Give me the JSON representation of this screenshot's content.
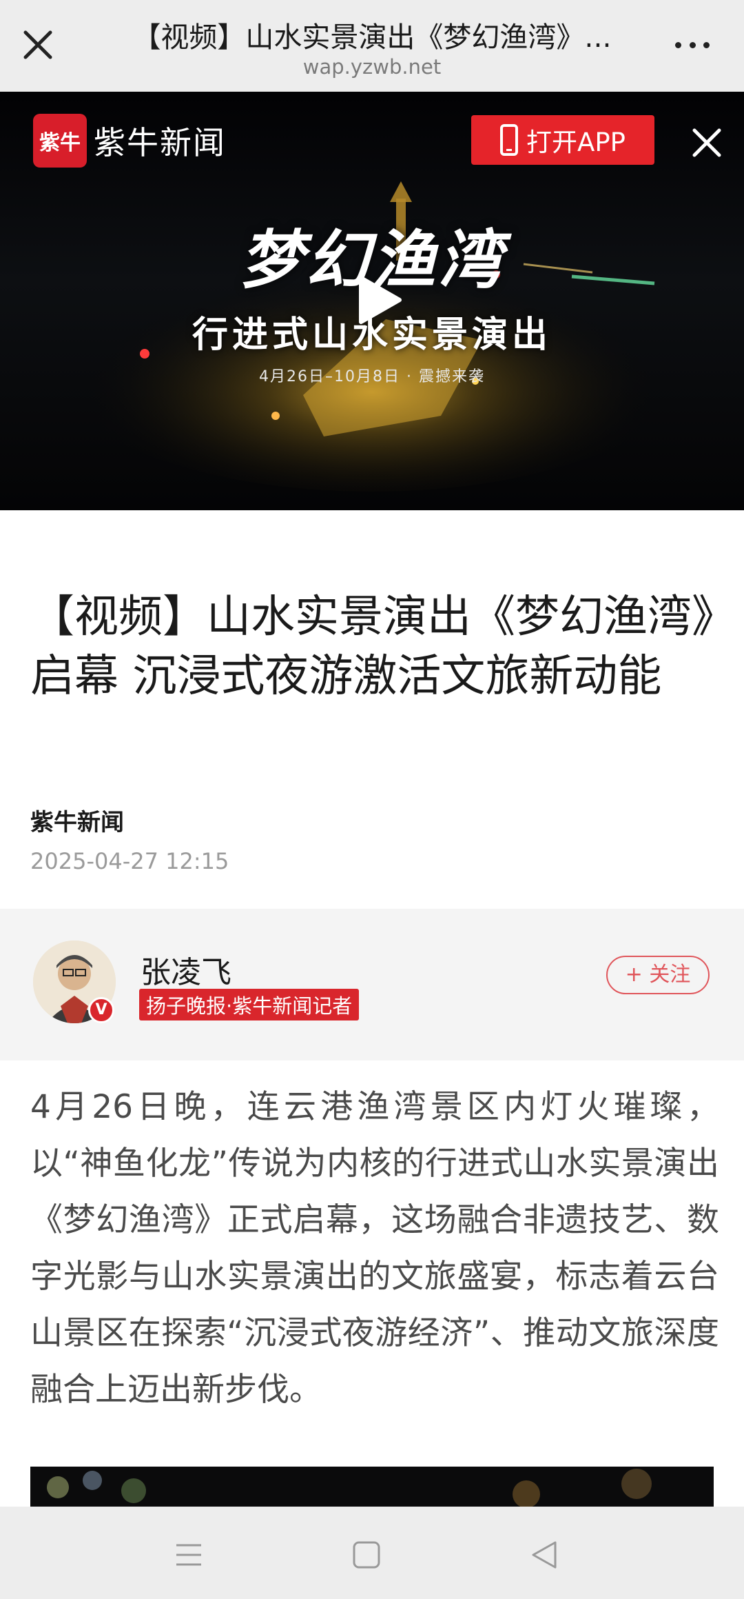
{
  "browser": {
    "title": "【视频】山水实景演出《梦幻渔湾》...",
    "domain": "wap.yzwb.net"
  },
  "hero": {
    "logo_badge": "紫牛",
    "logo_text": "紫牛新闻",
    "open_app_label": "打开APP",
    "video_title": "梦幻渔湾",
    "video_subtitle": "行进式山水实景演出",
    "video_date": "4月26日–10月8日 · 震撼来袭"
  },
  "article": {
    "headline": "【视频】山水实景演出《梦幻渔湾》启幕 沉浸式夜游激活文旅新动能",
    "source": "紫牛新闻",
    "date": "2025-04-27 12:15",
    "author": {
      "name": "张凌飞",
      "role": "扬子晚报·紫牛新闻记者",
      "verified_badge": "V",
      "follow_label": "+ 关注"
    },
    "paragraph": "4月26日晚，连云港渔湾景区内灯火璀璨，以“神鱼化龙”传说为内核的行进式山水实景演出《梦幻渔湾》正式启幕，这场融合非遗技艺、数字光影与山水实景演出的文旅盛宴，标志着云台山景区在探索“沉浸式夜游经济”、推动文旅深度融合上迈出新步伐。"
  },
  "navbar": {
    "icons": [
      "menu-icon",
      "home-square-icon",
      "back-triangle-icon"
    ]
  },
  "colors": {
    "accent_red": "#d9262c",
    "topbar_bg": "#ededed",
    "author_bg": "#f4f4f4"
  }
}
